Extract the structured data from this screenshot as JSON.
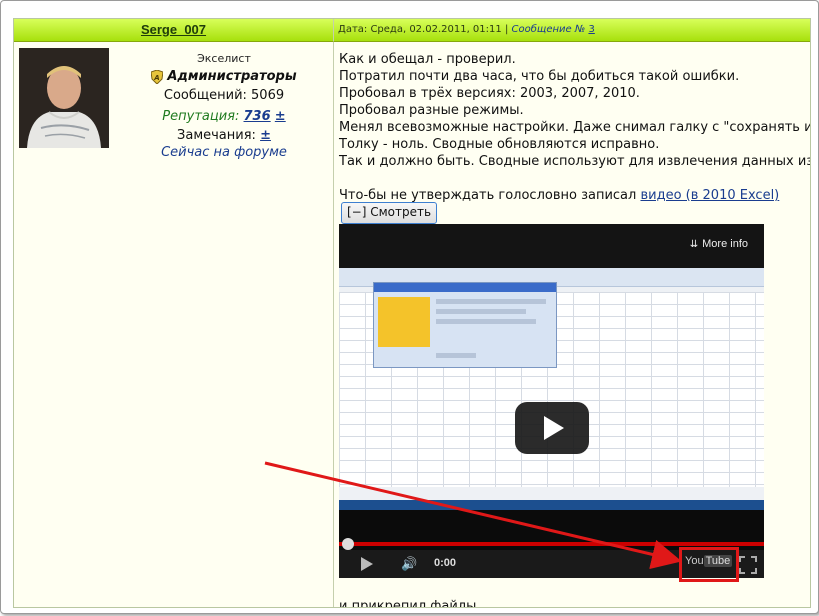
{
  "header": {
    "username": "Serge_007",
    "date_label": "Дата: Среда, 02.02.2011, 01:11",
    "separator": "|",
    "message_label": "Сообщение №",
    "message_number": "3"
  },
  "user": {
    "rank": "Экселист",
    "group": "Администраторы",
    "posts": "Сообщений: 5069",
    "reputation_label": "Репутация:",
    "reputation_value": "736",
    "reputation_pm": "±",
    "warnings_label": "Замечания:",
    "warnings_pm": "±",
    "status": "Сейчас на форуме"
  },
  "post": {
    "lines": [
      "Как и обещал - проверил.",
      "Потратил почти два часа, что бы добиться такой ошибки.",
      "Пробовал в трёх версиях: 2003, 2007, 2010.",
      "Пробовал разные режимы.",
      "Менял всевозможные настройки. Даже снимал галку с \"сохранять и",
      "Толку - ноль. Сводные обновляются исправно.",
      "Так и должно быть. Сводные используют для извлечения данных из"
    ],
    "video_intro": "Что-бы не утверждать голословно записал",
    "video_link": "видео (в 2010 Excel)",
    "toggle_button": "[−] Смотреть",
    "after_text": "и прикрепил файлы ."
  },
  "video": {
    "more_info": "More info",
    "time": "0:00",
    "logo_you": "You",
    "logo_tube": "Tube",
    "progress_fraction": 0
  },
  "colors": {
    "header_green": "#b5ec16",
    "link_blue": "#1a3d8f",
    "reputation_green": "#1f7a1f",
    "arrow_red": "#e01818"
  }
}
